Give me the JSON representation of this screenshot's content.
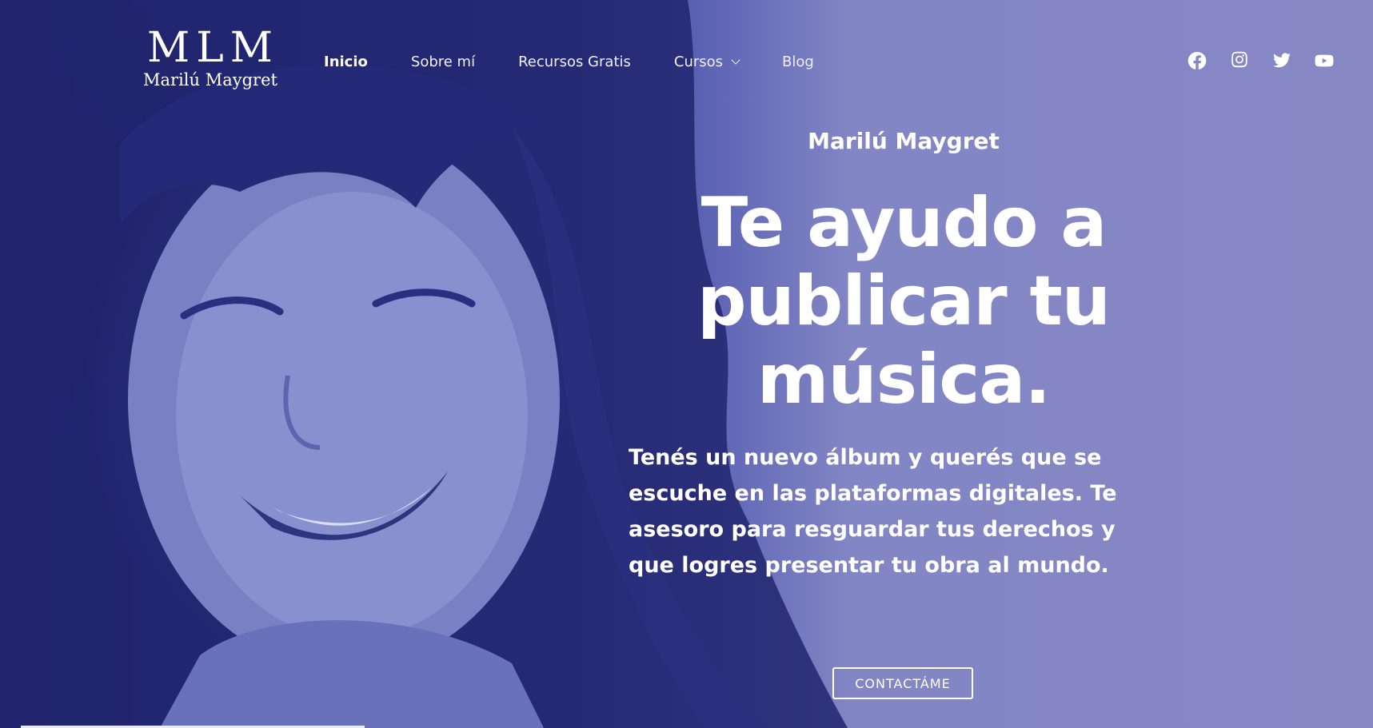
{
  "brand": {
    "mark": "MLM",
    "name": "Marilú Maygret"
  },
  "nav": {
    "items": [
      {
        "label": "Inicio",
        "active": true
      },
      {
        "label": "Sobre mí"
      },
      {
        "label": "Recursos Gratis"
      },
      {
        "label": "Cursos",
        "has_dropdown": true
      },
      {
        "label": "Blog"
      }
    ]
  },
  "social": [
    "facebook-icon",
    "instagram-icon",
    "twitter-icon",
    "youtube-icon"
  ],
  "hero": {
    "eyebrow": "Marilú Maygret",
    "headline_lines": [
      "Te ayudo a",
      "publicar tu",
      "música."
    ],
    "lead": "Tenés un nuevo álbum y querés que se escuche en las plataformas digitales. Te asesoro para resguardar tus derechos y que logres presentar tu obra al mundo.",
    "cta_label": "CONTACTÁME"
  },
  "colors": {
    "deep": "#1c1f66",
    "mid": "#5f65b5",
    "light": "#8688c4",
    "text": "#ffffff"
  }
}
